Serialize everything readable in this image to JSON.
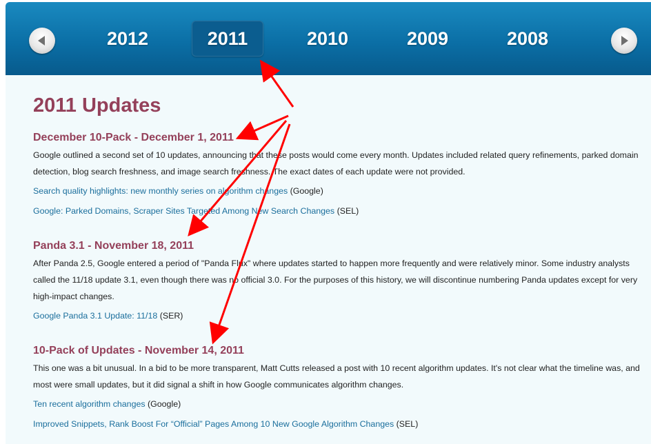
{
  "nav": {
    "years": [
      "2012",
      "2011",
      "2010",
      "2009",
      "2008"
    ],
    "active_year": "2011",
    "prev_icon": "arrow-left-icon",
    "next_icon": "arrow-right-icon"
  },
  "page": {
    "title": "2011 Updates"
  },
  "entries": [
    {
      "title": "December 10-Pack - December 1, 2011",
      "body": "Google outlined a second set of 10 updates, announcing that these posts would come every month. Updates included related query refinements, parked domain detection, blog search freshness, and image search freshness. The exact dates of each update were not provided.",
      "links": [
        {
          "text": "Search quality highlights: new monthly series on algorithm changes",
          "source": " (Google)"
        },
        {
          "text": "Google: Parked Domains, Scraper Sites Targeted Among New Search Changes",
          "source": " (SEL)"
        }
      ]
    },
    {
      "title": "Panda 3.1 - November 18, 2011",
      "body": "After Panda 2.5, Google entered a period of \"Panda Flux\" where updates started to happen more frequently and were relatively minor. Some industry analysts called the 11/18 update 3.1, even though there was no official 3.0. For the purposes of this history, we will discontinue numbering Panda updates except for very high-impact changes.",
      "links": [
        {
          "text": "Google Panda 3.1 Update: 11/18",
          "source": " (SER)"
        }
      ]
    },
    {
      "title": "10-Pack of Updates - November 14, 2011",
      "body": "This one was a bit unusual. In a bid to be more transparent, Matt Cutts released a post with 10 recent algorithm updates. It's not clear what the timeline was, and most were small updates, but it did signal a shift in how Google communicates algorithm changes.",
      "links": [
        {
          "text": "Ten recent algorithm changes",
          "source": " (Google)"
        },
        {
          "text": "Improved Snippets, Rank Boost For “Official” Pages Among 10 New Google Algorithm Changes",
          "source": " (SEL)"
        }
      ]
    }
  ],
  "colors": {
    "header": "#0b6fa6",
    "heading": "#94405a",
    "link": "#1a6e9c",
    "annotation": "#ff0000"
  }
}
